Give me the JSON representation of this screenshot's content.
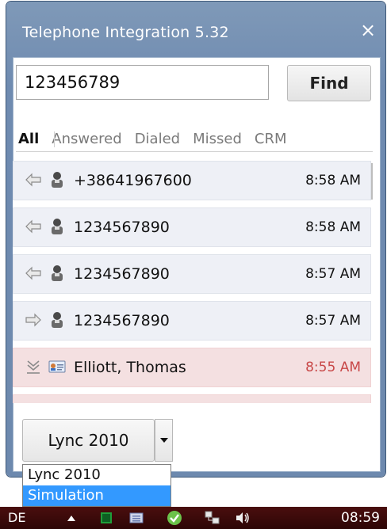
{
  "window": {
    "title": "Telephone Integration 5.32",
    "close_label": "×"
  },
  "search": {
    "value": "123456789",
    "find_label": "Find"
  },
  "tabs": [
    {
      "label": "All",
      "active": true
    },
    {
      "label": "Answered",
      "active": false
    },
    {
      "label": "Dialed",
      "active": false
    },
    {
      "label": "Missed",
      "active": false
    },
    {
      "label": "CRM",
      "active": false
    }
  ],
  "calls": [
    {
      "text": "+38641967600",
      "time": "8:58 AM",
      "direction_icon": "incoming-call-icon",
      "contact_icon": "person-icon",
      "missed": false
    },
    {
      "text": "1234567890",
      "time": "8:58 AM",
      "direction_icon": "incoming-call-icon",
      "contact_icon": "person-icon",
      "missed": false
    },
    {
      "text": "1234567890",
      "time": "8:57 AM",
      "direction_icon": "incoming-call-icon",
      "contact_icon": "person-icon",
      "missed": false
    },
    {
      "text": "1234567890",
      "time": "8:57 AM",
      "direction_icon": "outgoing-call-icon",
      "contact_icon": "person-icon",
      "missed": false
    },
    {
      "text": "Elliott, Thomas",
      "time": "8:55 AM",
      "direction_icon": "missed-call-icon",
      "contact_icon": "contact-card-icon",
      "missed": true
    }
  ],
  "provider": {
    "selected": "Lync 2010",
    "options": [
      {
        "label": "Lync 2010",
        "highlighted": false
      },
      {
        "label": "Simulation",
        "highlighted": true
      }
    ]
  },
  "taskbar": {
    "language": "DE",
    "clock": "08:59"
  },
  "colors": {
    "window_frame": "#6d89ae",
    "missed_row": "#f4e0e1",
    "missed_time": "#c84848",
    "dropdown_highlight": "#3399ff",
    "taskbar": "#3a0a0a"
  }
}
